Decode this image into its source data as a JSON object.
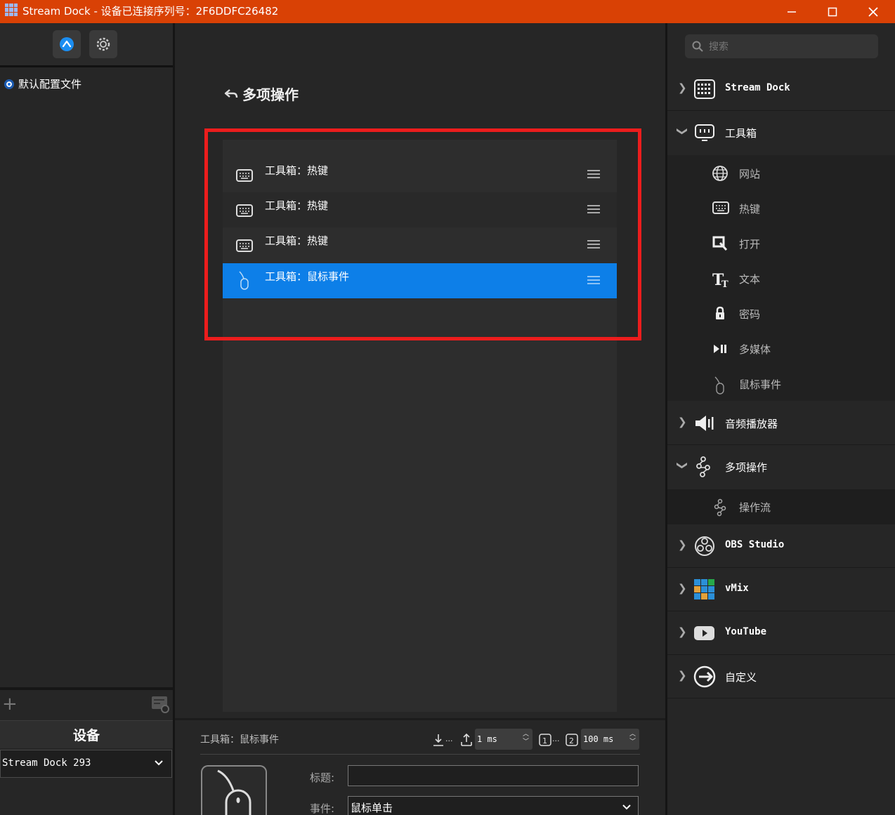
{
  "window": {
    "title": "Stream Dock - 设备已连接序列号：2F6DDFC26482"
  },
  "sidebar": {
    "profile_label": "默认配置文件",
    "device_header": "设备",
    "device_selected": "Stream Dock 293",
    "add_label": "+"
  },
  "main": {
    "page_title": "多项操作",
    "actions": [
      {
        "label": "工具箱：热键",
        "icon": "keyboard-icon"
      },
      {
        "label": "工具箱：热键",
        "icon": "keyboard-icon"
      },
      {
        "label": "工具箱：热键",
        "icon": "keyboard-icon"
      },
      {
        "label": "工具箱：鼠标事件",
        "icon": "mouse-icon",
        "selected": true
      }
    ],
    "highlight_color": "#ec1d1d",
    "selected_color": "#0d7fe8"
  },
  "properties": {
    "title": "工具箱：鼠标事件",
    "delay_value": "1 ms",
    "interval_value": "100 ms",
    "title_label": "标题:",
    "title_value": "",
    "event_label": "事件:",
    "event_value": "鼠标单击"
  },
  "library": {
    "search_placeholder": "搜索",
    "categories": [
      {
        "label": "Stream Dock",
        "icon": "grid-keypad-icon",
        "expanded": false
      },
      {
        "label": "工具箱",
        "icon": "toolbox-icon",
        "expanded": true,
        "items": [
          {
            "label": "网站",
            "icon": "globe-icon"
          },
          {
            "label": "热键",
            "icon": "keyboard-icon"
          },
          {
            "label": "打开",
            "icon": "open-icon"
          },
          {
            "label": "文本",
            "icon": "text-icon"
          },
          {
            "label": "密码",
            "icon": "lock-icon"
          },
          {
            "label": "多媒体",
            "icon": "play-pause-icon"
          },
          {
            "label": "鼠标事件",
            "icon": "mouse-icon"
          }
        ]
      },
      {
        "label": "音频播放器",
        "icon": "speaker-icon",
        "expanded": false
      },
      {
        "label": "多项操作",
        "icon": "multi-action-icon",
        "expanded": true,
        "items": [
          {
            "label": "操作流",
            "icon": "flow-icon"
          }
        ]
      },
      {
        "label": "OBS Studio",
        "icon": "obs-icon",
        "expanded": false
      },
      {
        "label": "vMix",
        "icon": "vmix-icon",
        "expanded": false
      },
      {
        "label": "YouTube",
        "icon": "youtube-icon",
        "expanded": false
      },
      {
        "label": "自定义",
        "icon": "custom-icon",
        "expanded": false
      }
    ]
  },
  "colors": {
    "titlebar": "#d94105",
    "accent_blue": "#1873e8"
  }
}
